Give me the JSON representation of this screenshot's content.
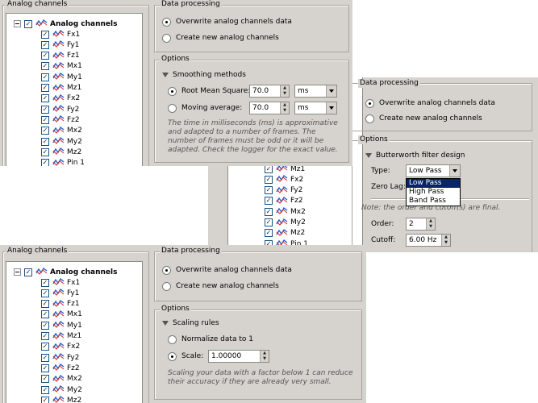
{
  "colors": {
    "panel_bg": "#d6d3ce",
    "selection": "#0a246a",
    "tree_bg": "#ffffff"
  },
  "panel1": {
    "tree_group_title": "Analog channels",
    "tree_root": "Analog channels",
    "channels": [
      "Fx1",
      "Fy1",
      "Fz1",
      "Mx1",
      "My1",
      "Mz1",
      "Fx2",
      "Fy2",
      "Fz2",
      "Mx2",
      "My2",
      "Mz2",
      "Pin 1"
    ],
    "processing_title": "Data processing",
    "overwrite_label": "Overwrite analog channels data",
    "create_label": "Create new analog channels",
    "options_title": "Options",
    "section_label": "Smoothing methods",
    "rms_label": "Root Mean Square:",
    "rms_value": "70.0",
    "rms_unit": "ms",
    "ma_label": "Moving average:",
    "ma_value": "70.0",
    "ma_unit": "ms",
    "note": "The time in milliseconds (ms) is approximative and adapted to a number of frames. The number of frames must be odd or it will be adapted. Check the logger for the exact value."
  },
  "panel2": {
    "channels": [
      "Mz1",
      "Fx2",
      "Fy2",
      "Fz2",
      "Mx2",
      "My2",
      "Mz2",
      "Pin 1"
    ],
    "processing_title": "Data processing",
    "overwrite_label": "Overwrite analog channels data",
    "create_label": "Create new analog channels",
    "options_title": "Options",
    "section_label": "Butterworth filter design",
    "type_label": "Type:",
    "type_value": "Low Pass",
    "type_options": [
      "Low Pass",
      "High Pass",
      "Band Pass"
    ],
    "zero_lag_label": "Zero Lag:",
    "note": "Note: the order and cutoff(s) are final.",
    "order_label": "Order:",
    "order_value": "2",
    "cutoff_label": "Cutoff:",
    "cutoff_value": "6.00 Hz"
  },
  "panel3": {
    "tree_group_title": "Analog channels",
    "tree_root": "Analog channels",
    "channels": [
      "Fx1",
      "Fy1",
      "Fz1",
      "Mx1",
      "My1",
      "Mz1",
      "Fx2",
      "Fy2",
      "Fz2",
      "Mx2",
      "My2",
      "Mz2"
    ],
    "processing_title": "Data processing",
    "overwrite_label": "Overwrite analog channels data",
    "create_label": "Create new analog channels",
    "options_title": "Options",
    "section_label": "Scaling rules",
    "normalize_label": "Normalize data to 1",
    "scale_label": "Scale:",
    "scale_value": "1.00000",
    "note": "Scaling your data with a factor below 1 can reduce their accuracy if they are already very small."
  }
}
